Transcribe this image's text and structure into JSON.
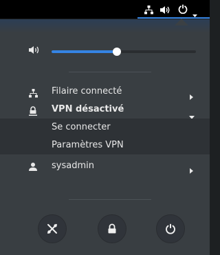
{
  "topbar": {
    "icons": [
      "network-wired-icon",
      "volume-icon",
      "power-icon",
      "dropdown-arrow-icon"
    ],
    "accent_color": "#3584e4"
  },
  "volume": {
    "icon": "volume-icon",
    "level_fraction": 0.45
  },
  "menu": {
    "wired": {
      "label": "Filaire connecté",
      "icon": "network-wired-icon"
    },
    "vpn": {
      "label": "VPN désactivé",
      "icon": "vpn-lock-icon"
    },
    "vpn_items": [
      {
        "label": "Se connecter"
      },
      {
        "label": "Paramètres VPN"
      }
    ],
    "user": {
      "label": "sysadmin",
      "icon": "user-icon"
    }
  },
  "actions": [
    "settings-icon",
    "lock-icon",
    "power-icon"
  ]
}
